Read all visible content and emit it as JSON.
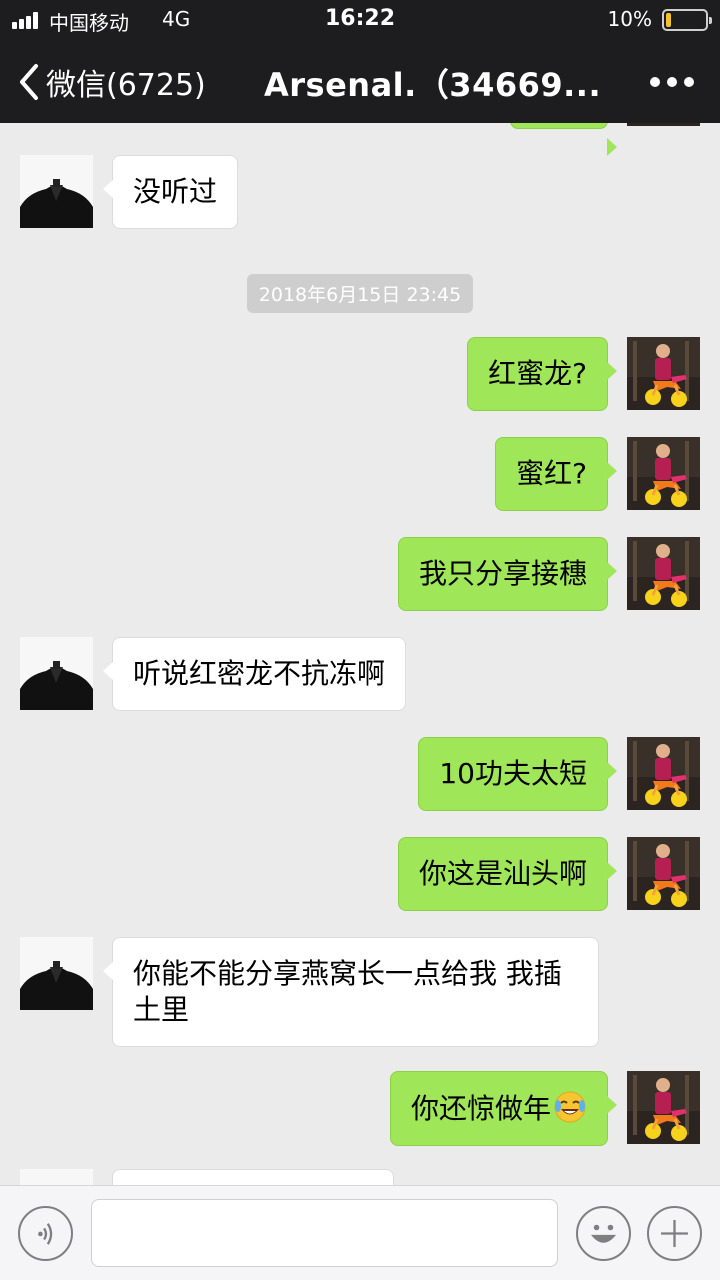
{
  "status_bar": {
    "carrier": "中国移动",
    "network": "4G",
    "time": "16:22",
    "battery_percent": "10%",
    "battery_color": "#f6c22b"
  },
  "nav": {
    "back_label": "微信(6725)",
    "title": "Arsenal.（34669...",
    "back_icon": "chevron-left-icon",
    "more_icon": "more-dots-icon"
  },
  "chat": {
    "timestamp": "2018年6月15日 23:45",
    "messages": [
      {
        "id": "m1",
        "side": "in",
        "text": "没听过"
      },
      {
        "id": "m2",
        "side": "out",
        "text": "红蜜龙?"
      },
      {
        "id": "m3",
        "side": "out",
        "text": "蜜红?"
      },
      {
        "id": "m4",
        "side": "out",
        "text": "我只分享接穗"
      },
      {
        "id": "m5",
        "side": "in",
        "text": "听说红密龙不抗冻啊"
      },
      {
        "id": "m6",
        "side": "out",
        "text": "10功夫太短"
      },
      {
        "id": "m7",
        "side": "out",
        "text": "你这是汕头啊"
      },
      {
        "id": "m8",
        "side": "in",
        "text": "你能不能分享燕窝长一点给我 我插土里"
      },
      {
        "id": "m9",
        "side": "out",
        "text": "你还惊做年",
        "emoji": "tears-of-joy-emoji-icon"
      }
    ]
  },
  "input_bar": {
    "voice_icon": "voice-icon",
    "emoji_icon": "smiley-icon",
    "plus_icon": "plus-icon",
    "placeholder": ""
  },
  "colors": {
    "outgoing_bubble": "#9fe658",
    "incoming_bubble": "#ffffff",
    "chat_background": "#ebebeb",
    "header_background": "#1d1d1f"
  }
}
